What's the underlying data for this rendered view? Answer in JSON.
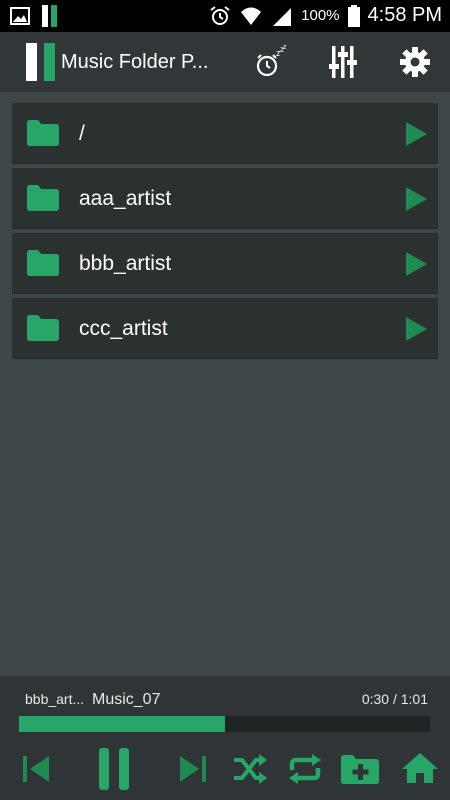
{
  "status_bar": {
    "battery_percent": "100%",
    "time": "4:58 PM"
  },
  "action_bar": {
    "title": "Music Folder P...",
    "icons": [
      "sleep-timer-icon",
      "equalizer-icon",
      "settings-icon"
    ]
  },
  "folders": [
    {
      "name": "/"
    },
    {
      "name": "aaa_artist"
    },
    {
      "name": "bbb_artist"
    },
    {
      "name": "ccc_artist"
    }
  ],
  "player": {
    "artist": "bbb_art...",
    "track": "Music_07",
    "time": "0:30 / 1:01",
    "progress": 0.5,
    "controls": [
      "previous",
      "pause",
      "next",
      "shuffle",
      "repeat",
      "add-folder",
      "home"
    ]
  },
  "colors": {
    "accent": "#27a668",
    "background": "#3e4748",
    "row": "#2b3031",
    "actionbar": "#313738"
  }
}
